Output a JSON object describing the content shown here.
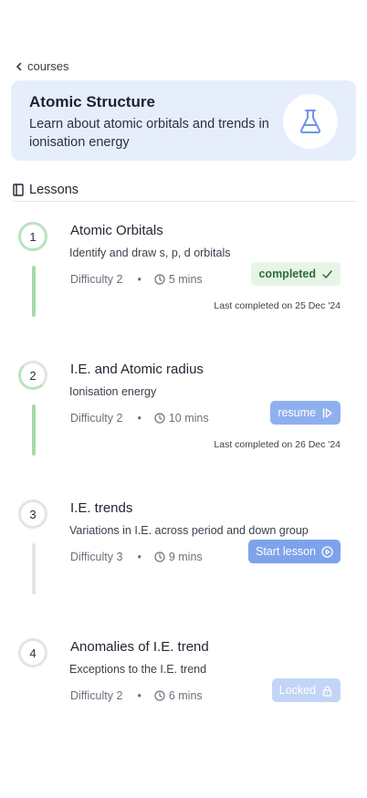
{
  "back": {
    "label": "courses"
  },
  "course": {
    "title": "Atomic Structure",
    "description": "Learn about atomic orbitals and trends in ionisation energy",
    "icon": "flask-icon"
  },
  "section": {
    "title": "Lessons"
  },
  "colors": {
    "accent": "#7ea3ea",
    "hero_bg": "#e6eefc",
    "done_green": "#a6dba9",
    "completed_bg": "#e6f5e6"
  },
  "lessons": [
    {
      "number": "1",
      "title": "Atomic Orbitals",
      "subtitle": "Identify and draw s, p, d orbitals",
      "difficulty": "Difficulty 2",
      "separator": "•",
      "duration": "5 mins",
      "action": "completed",
      "last": "Last completed on 25 Dec '24"
    },
    {
      "number": "2",
      "title": "I.E. and Atomic radius",
      "subtitle": "Ionisation energy",
      "difficulty": "Difficulty 2",
      "separator": "•",
      "duration": "10 mins",
      "action": "resume",
      "last": "Last completed on 26 Dec '24"
    },
    {
      "number": "3",
      "title": "I.E. trends",
      "subtitle": "Variations in I.E. across period and down group",
      "difficulty": "Difficulty 3",
      "separator": "•",
      "duration": "9 mins",
      "action": "Start lesson",
      "last": ""
    },
    {
      "number": "4",
      "title": "Anomalies of I.E. trend",
      "subtitle": "Exceptions to the I.E. trend",
      "difficulty": "Difficulty 2",
      "separator": "•",
      "duration": "6 mins",
      "action": "Locked",
      "last": ""
    }
  ]
}
